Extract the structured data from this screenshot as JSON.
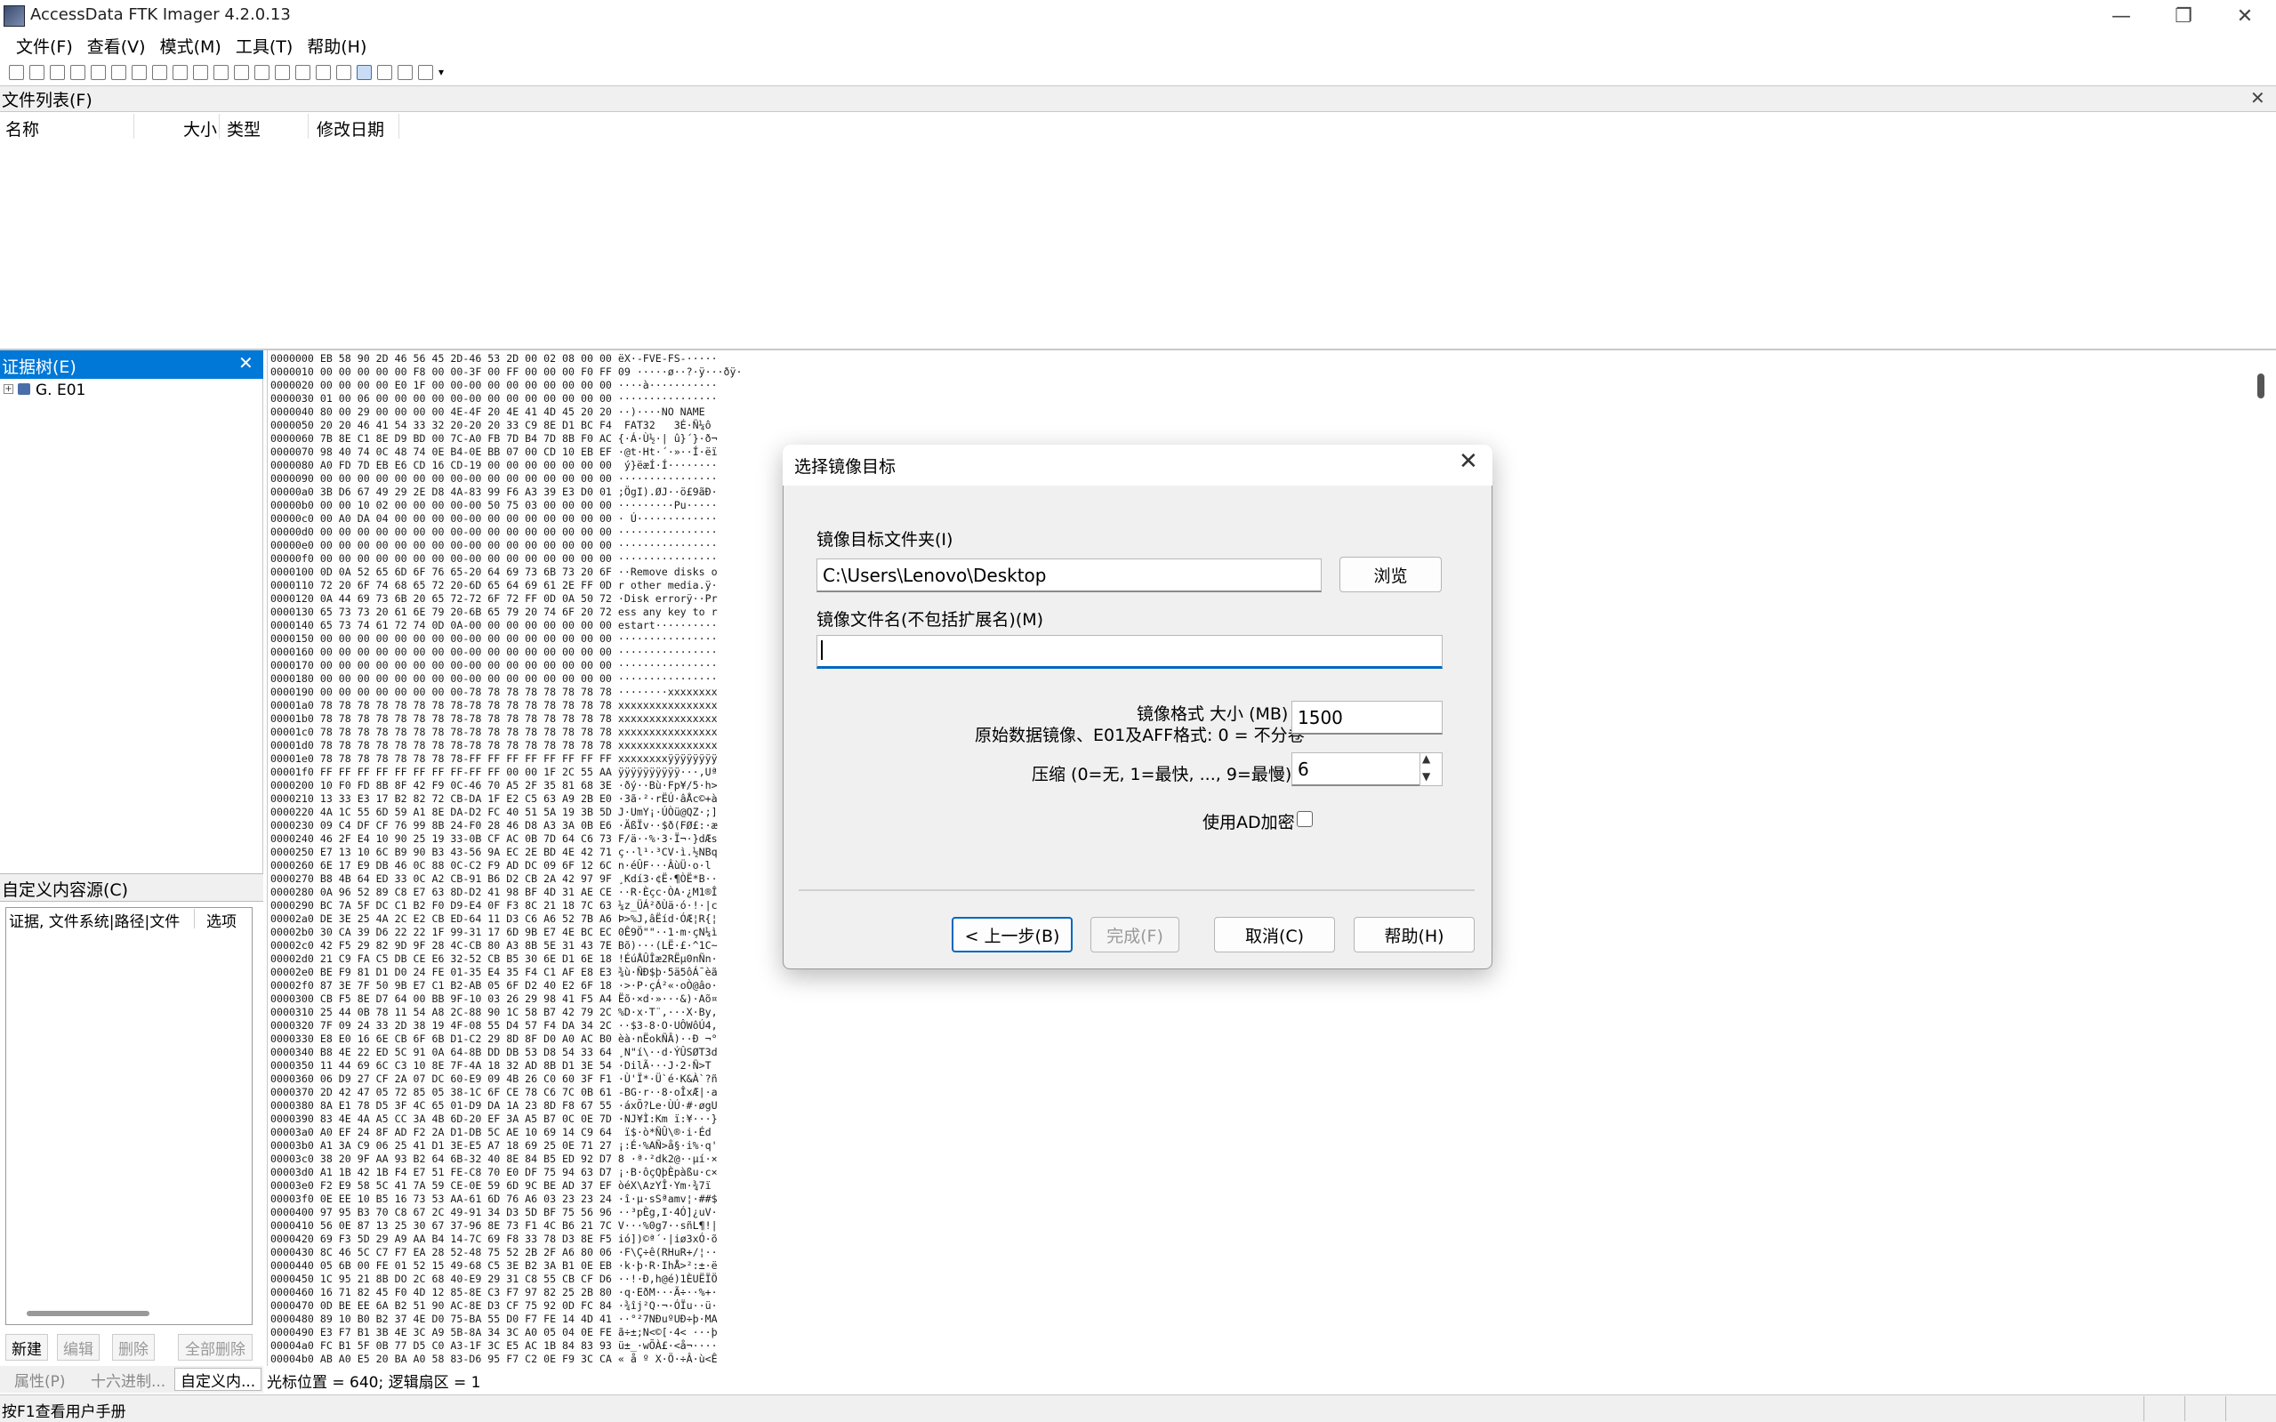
{
  "window": {
    "title": "AccessData FTK Imager 4.2.0.13"
  },
  "menu": [
    "文件(F)",
    "查看(V)",
    "模式(M)",
    "工具(T)",
    "帮助(H)"
  ],
  "file_list": {
    "title": "文件列表(F)",
    "columns": [
      "名称",
      "大小",
      "类型",
      "修改日期"
    ]
  },
  "evidence_tree": {
    "title": "证据树(E)",
    "expander": "+",
    "item": "G. E01"
  },
  "custom_sources": {
    "title": "自定义内容源(C)",
    "col1": "证据, 文件系统|路径|文件",
    "col2": "选项",
    "buttons": [
      "新建",
      "编辑",
      "删除",
      "全部删除"
    ]
  },
  "bottom_tabs": [
    "属性(P)",
    "十六进制...",
    "自定义内..."
  ],
  "cursor_status": "光标位置 = 640; 逻辑扇区 = 1",
  "status_text": "按F1查看用户手册",
  "hex_rows": [
    "0000000 EB 58 90 2D 46 56 45 2D-46 53 2D 00 02 08 00 00 ëX·-FVE-FS-·····",
    "0000010 00 00 00 00 00 F8 00 00-3F 00 FF 00 00 00 F0 FF 09 ·····ø··?·ÿ···ðÿ·",
    "0000020 00 00 00 00 E0 1F 00 00-00 00 00 00 00 00 00 00 ····à···········",
    "0000030 01 00 06 00 00 00 00 00-00 00 00 00 00 00 00 00 ················",
    "0000040 80 00 29 00 00 00 00 4E-4F 20 4E 41 4D 45 20 20 ··)····NO NAME  ",
    "0000050 20 20 46 41 54 33 32 20-20 20 33 C9 8E D1 BC F4  FAT32   3É·Ñ¼ô",
    "0000060 7B 8E C1 8E D9 BD 00 7C-A0 FB 7D B4 7D 8B F0 AC {·Á·Ù½·| û}´}·ð¬",
    "0000070 98 40 74 0C 48 74 0E B4-0E BB 07 00 CD 10 EB EF ·@t·Ht·´·»··Í·ëï",
    "0000080 A0 FD 7D EB E6 CD 16 CD-19 00 00 00 00 00 00 00  ý}ëæÍ·Í········",
    "0000090 00 00 00 00 00 00 00 00-00 00 00 00 00 00 00 00 ················",
    "00000a0 3B D6 67 49 29 2E D8 4A-83 99 F6 A3 39 E3 D0 01 ;ÖgI).ØJ··ö£9ãÐ·",
    "00000b0 00 00 10 02 00 00 00 00-00 50 75 03 00 00 00 00 ·········Pu·····",
    "00000c0 00 A0 DA 04 00 00 00 00-00 00 00 00 00 00 00 00 · Ú·············",
    "00000d0 00 00 00 00 00 00 00 00-00 00 00 00 00 00 00 00 ················",
    "00000e0 00 00 00 00 00 00 00 00-00 00 00 00 00 00 00 00 ················",
    "00000f0 00 00 00 00 00 00 00 00-00 00 00 00 00 00 00 00 ················",
    "0000100 0D 0A 52 65 6D 6F 76 65-20 64 69 73 6B 73 20 6F ··Remove disks o",
    "0000110 72 20 6F 74 68 65 72 20-6D 65 64 69 61 2E FF 0D r other media.ÿ·",
    "0000120 0A 44 69 73 6B 20 65 72-72 6F 72 FF 0D 0A 50 72 ·Disk errorÿ··Pr",
    "0000130 65 73 73 20 61 6E 79 20-6B 65 79 20 74 6F 20 72 ess any key to r",
    "0000140 65 73 74 61 72 74 0D 0A-00 00 00 00 00 00 00 00 estart··········",
    "0000150 00 00 00 00 00 00 00 00-00 00 00 00 00 00 00 00 ················",
    "0000160 00 00 00 00 00 00 00 00-00 00 00 00 00 00 00 00 ················",
    "0000170 00 00 00 00 00 00 00 00-00 00 00 00 00 00 00 00 ················",
    "0000180 00 00 00 00 00 00 00 00-00 00 00 00 00 00 00 00 ················",
    "0000190 00 00 00 00 00 00 00 00-78 78 78 78 78 78 78 78 ········xxxxxxxx",
    "00001a0 78 78 78 78 78 78 78 78-78 78 78 78 78 78 78 78 xxxxxxxxxxxxxxxx",
    "00001b0 78 78 78 78 78 78 78 78-78 78 78 78 78 78 78 78 xxxxxxxxxxxxxxxx",
    "00001c0 78 78 78 78 78 78 78 78-78 78 78 78 78 78 78 78 xxxxxxxxxxxxxxxx",
    "00001d0 78 78 78 78 78 78 78 78-78 78 78 78 78 78 78 78 xxxxxxxxxxxxxxxx",
    "00001e0 78 78 78 78 78 78 78 78-FF FF FF FF FF FF FF FF xxxxxxxxÿÿÿÿÿÿÿÿ",
    "00001f0 FF FF FF FF FF FF FF FF-FF FF 00 00 1F 2C 55 AA ÿÿÿÿÿÿÿÿÿÿ···,Uª",
    "0000200 10 F0 FD 8B 8F 42 F9 0C-46 70 A5 2F 35 81 68 3E ·ðý··Bù·Fp¥/5·h>",
    "0000210 13 33 E3 17 B2 82 72 CB-DA 1F E2 C5 63 A9 2B E0 ·3ã·²·rËÚ·âÅc©+à",
    "0000220 4A 1C 55 6D 59 A1 8E DA-D2 FC 40 51 5A 19 3B 5D J·UmY¡·ÚÒü@QZ·;]",
    "0000230 09 C4 DF CF 76 99 8B 24-F0 28 46 D8 A3 3A 0B E6 ·ÄßÏv··$ð(FØ£:·æ",
    "0000240 46 2F E4 10 90 25 19 33-0B CF AC 0B 7D 64 C6 73 F/ä··%·3·Ï¬·}dÆs",
    "0000250 E7 13 10 6C B9 90 B3 43-56 9A EC 2E BD 4E 42 71 ç··l¹·³CV·ì.½NBq",
    "0000260 6E 17 E9 DB 46 0C 88 0C-C2 F9 AD DC 09 6F 12 6C n·éÛF···Âù­Ü·o·l",
    "0000270 B8 4B 64 ED 33 0C A2 CB-91 B6 D2 CB 2A 42 97 9F ¸Kdí3·¢Ë·¶ÒË*B··",
    "0000280 0A 96 52 89 C8 E7 63 8D-D2 41 98 BF 4D 31 AE CE ··R·Èçc·ÒA·¿M1®Î",
    "0000290 BC 7A 5F DC C1 B2 F0 D9-E4 0F F3 8C 21 18 7C 63 ¼z_ÜÁ²ðÙä·ó·!·|c",
    "00002a0 DE 3E 25 4A 2C E2 CB ED-64 11 D3 C6 A6 52 7B A6 Þ>%J,âËíd·ÓÆ¦R{¦",
    "00002b0 30 CA 39 D6 22 22 1F 99-31 17 6D 9B E7 4E BC EC 0Ê9Ö\"\"··1·m·çN¼ì",
    "00002c0 42 F5 29 82 9D 9F 28 4C-CB 80 A3 8B 5E 31 43 7E Bõ)···(LË·£·^1C~",
    "00002d0 21 C9 FA C5 DB CE E6 32-52 CB B5 30 6E D1 6E 18 !ÉúÅÛÎæ2RËµ0nÑn·",
    "00002e0 BE F9 81 D1 D0 24 FE 01-35 E4 35 F4 C1 AF E8 E3 ¾ù·ÑÐ$þ·5ä5ôÁ¯èã",
    "00002f0 87 3E 7F 50 9B E7 C1 B2-AB 05 6F D2 40 E2 6F 18 ·>·P·çÁ²«·oÒ@âo·",
    "0000300 CB F5 8E D7 64 00 BB 9F-10 03 26 29 98 41 F5 A4 Ëõ·×d·»···&)·Aõ¤",
    "0000310 25 44 0B 78 11 54 A8 2C-88 90 1C 58 B7 42 79 2C %D·x·T¨,···X·By,",
    "0000320 7F 09 24 33 2D 38 19 4F-08 55 D4 57 F4 DA 34 2C ··$3-8·O·UÔWôÚ4,",
    "0000330 E8 E0 16 6E CB 6F 6B D1-C2 29 8D 8F D0 A0 AC B0 èà·nËokÑÂ)··Ð ¬°",
    "0000340 B8 4E 22 ED 5C 91 0A 64-8B DD DB 53 D8 54 33 64 ¸N\"í\\··d·ÝÛSØT3d",
    "0000350 11 44 69 6C C3 10 8E 7F-4A 18 32 AD 8B D1 3E 54 ·DilÃ···J·2­·Ñ>T",
    "0000360 06 D9 27 CF 2A 07 DC 60-E9 09 4B 26 C0 60 3F F1 ·Ù'Ï*·Ü`é·K&À`?ñ",
    "0000370 2D 42 47 05 72 85 05 38-1C 6F CE 78 C6 7C 0B 61 -BG·r··8·oÎxÆ|·a",
    "0000380 8A E1 78 D5 3F 4C 65 01-D9 DA 1A 23 8D F8 67 55 ·áxÕ?Le·ÙÚ·#·øgU",
    "0000390 83 4E 4A A5 CC 3A 4B 6D-20 EF 3A A5 B7 0C 0E 7D ·NJ¥Ì:Km ï:¥···}",
    "00003a0 A0 EF 24 8F AD F2 2A D1-DB 5C AE 10 69 14 C9 64  ï$·­ò*ÑÛ\\®·i·Éd",
    "00003b0 A1 3A C9 06 25 41 D1 3E-E5 A7 18 69 25 0E 71 27 ¡:É·%AÑ>å§·i%·q'",
    "00003c0 38 20 9F AA 93 B2 64 6B-32 40 8E 84 B5 ED 92 D7 8 ·ª·²dk2@··µí·×",
    "00003d0 A1 1B 42 1B F4 E7 51 FE-C8 70 E0 DF 75 94 63 D7 ¡·B·ôçQþÈpàßu·c×",
    "00003e0 F2 E9 58 5C 41 7A 59 CE-0E 59 6D 9C BE AD 37 EF òéX\\AzYÎ·Ym·¾­7ï",
    "00003f0 0E EE 10 B5 16 73 53 AA-61 6D 76 A6 03 23 23 24 ·î·µ·sSªamv¦·##$",
    "0000400 97 95 B3 70 C8 67 2C 49-91 34 D3 5D BF 75 56 96 ··³pÈg,I·4Ó]¿uV·",
    "0000410 56 0E 87 13 25 30 67 37-96 8E 73 F1 4C B6 21 7C V···%0g7··sñL¶!|",
    "0000420 69 F3 5D 29 A9 AA B4 14-7C 69 F8 33 78 D3 8E F5 ió])©ª´·|iø3xÓ·õ",
    "0000430 8C 46 5C C7 F7 EA 28 52-48 75 52 2B 2F A6 80 06 ·F\\Ç÷ê(RHuR+/¦··",
    "0000440 05 6B 00 FE 01 52 15 49-68 C5 3E B2 3A B1 0E EB ·k·þ·R·IhÅ>²:±·ë",
    "0000450 1C 95 21 8B DO 2C 68 40-E9 29 31 C8 55 CB CF D6 ··!·Ð,h@é)1ÈUËÏÖ",
    "0000460 16 71 82 45 F0 4D 12 85-8E C3 F7 97 82 25 2B 80 ·q·EðM···Ã÷··%+·",
    "0000470 0D BE EE 6A B2 51 90 AC-8E D3 CF 75 92 0D FC 84 ·¾îj²Q·¬·ÓÏu··ü·",
    "0000480 89 10 B0 B2 37 4E D0 75-BA 55 D0 F7 FE 14 4D 41 ··°²7NÐuºUÐ÷þ·MA",
    "0000490 E3 F7 B1 3B 4E 3C A9 5B-8A 34 3C A0 05 04 0E FE ã÷±;N<©[·4< ···þ",
    "00004a0 FC B1 5F 0B 77 D5 C0 A3-1F 3C E5 AC 1B 84 83 93 ü±_·wÕÀ£·<å¬····",
    "00004b0 AB A0 E5 20 BA A0 58 83-D6 95 F7 C2 0E F9 3C CA « å º X·Ö·÷Â·ù<Ê"
  ],
  "dialog": {
    "title": "选择镜像目标",
    "folder_label": "镜像目标文件夹(I)",
    "folder_value": "C:\\Users\\Lenovo\\Desktop",
    "browse": "浏览",
    "filename_label": "镜像文件名(不包括扩展名)(M)",
    "filename_value": "",
    "fragment_label_1": "镜像格式 大小 (MB)",
    "fragment_label_2": "原始数据镜像、E01及AFF格式: 0 = 不分卷",
    "fragment_value": "1500",
    "compress_label": "压缩 (0=无, 1=最快, ..., 9=最慢)(P)",
    "compress_value": "6",
    "ad_encrypt_label": "使用AD加密",
    "back": "< 上一步(B)",
    "finish": "完成(F)",
    "cancel": "取消(C)",
    "help": "帮助(H)"
  }
}
